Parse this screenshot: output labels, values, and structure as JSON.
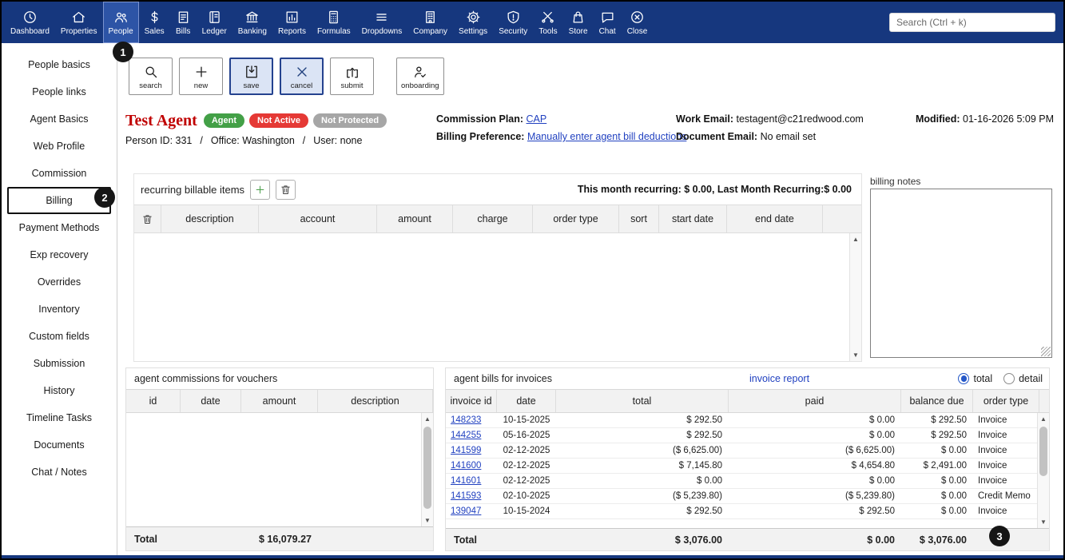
{
  "colors": {
    "nav_bg": "#16377e",
    "link": "#2141c0",
    "agent_name_red": "#c00000"
  },
  "annotations": {
    "one": "1",
    "two": "2",
    "three": "3"
  },
  "nav": {
    "search_placeholder": "Search (Ctrl + k)",
    "items": [
      {
        "label": "Dashboard",
        "icon": "dashboard-icon"
      },
      {
        "label": "Properties",
        "icon": "properties-icon"
      },
      {
        "label": "People",
        "icon": "people-icon",
        "selected": true
      },
      {
        "label": "Sales",
        "icon": "sales-icon"
      },
      {
        "label": "Bills",
        "icon": "bills-icon"
      },
      {
        "label": "Ledger",
        "icon": "ledger-icon"
      },
      {
        "label": "Banking",
        "icon": "banking-icon"
      },
      {
        "label": "Reports",
        "icon": "reports-icon"
      },
      {
        "label": "Formulas",
        "icon": "formulas-icon"
      },
      {
        "label": "Dropdowns",
        "icon": "dropdowns-icon"
      },
      {
        "label": "Company",
        "icon": "company-icon"
      },
      {
        "label": "Settings",
        "icon": "settings-icon"
      },
      {
        "label": "Security",
        "icon": "security-icon"
      },
      {
        "label": "Tools",
        "icon": "tools-icon"
      },
      {
        "label": "Store",
        "icon": "store-icon"
      },
      {
        "label": "Chat",
        "icon": "chat-icon"
      },
      {
        "label": "Close",
        "icon": "close-icon"
      }
    ]
  },
  "sidebar": {
    "selected": "Billing",
    "items": [
      "People basics",
      "People links",
      "Agent Basics",
      "Web Profile",
      "Commission",
      "Billing",
      "Payment Methods",
      "Exp recovery",
      "Overrides",
      "Inventory",
      "Custom fields",
      "Submission",
      "History",
      "Timeline Tasks",
      "Documents",
      "Chat / Notes"
    ]
  },
  "toolbar": {
    "buttons": [
      {
        "label": "search",
        "icon": "search-icon"
      },
      {
        "label": "new",
        "icon": "plus-icon"
      },
      {
        "label": "save",
        "icon": "save-icon",
        "highlighted": true
      },
      {
        "label": "cancel",
        "icon": "cancel-icon",
        "highlighted": true
      },
      {
        "label": "submit",
        "icon": "submit-icon"
      },
      {
        "label": "onboarding",
        "icon": "onboarding-icon",
        "spaced": true
      }
    ]
  },
  "agent": {
    "name": "Test Agent",
    "badges": [
      {
        "label": "Agent",
        "color": "#43a047"
      },
      {
        "label": "Not Active",
        "color": "#e53935"
      },
      {
        "label": "Not Protected",
        "color": "#a6a6a6"
      }
    ],
    "meta": {
      "person_id": "Person ID: 331",
      "separator": "/",
      "office": "Office: Washington",
      "user": "User: none"
    },
    "commission_plan_label": "Commission Plan:",
    "commission_plan_value": "CAP",
    "billing_pref_label": "Billing Preference:",
    "billing_pref_value": "Manually enter agent bill deductions",
    "work_email_label": "Work Email:",
    "work_email_value": "testagent@c21redwood.com",
    "document_email_label": "Document Email:",
    "document_email_value": "No email set",
    "modified_label": "Modified:",
    "modified_value": "01-16-2026 5:09 PM"
  },
  "recurring": {
    "title": "recurring billable items",
    "summary": "This month recurring: $ 0.00, Last Month Recurring:$ 0.00",
    "columns": [
      "description",
      "account",
      "amount",
      "charge",
      "order type",
      "sort",
      "start date",
      "end date"
    ]
  },
  "billing_notes": {
    "label": "billing notes"
  },
  "vouchers": {
    "title": "agent commissions for vouchers",
    "columns": [
      "id",
      "date",
      "amount",
      "description"
    ],
    "total_label": "Total",
    "total_amount": "$ 16,079.27"
  },
  "invoices": {
    "title": "agent bills for invoices",
    "report_link": "invoice report",
    "radio_total": "total",
    "radio_detail": "detail",
    "columns": [
      "invoice id",
      "date",
      "total",
      "paid",
      "balance due",
      "order type"
    ],
    "rows": [
      {
        "id": "148233",
        "date": "10-15-2025",
        "total": "$ 292.50",
        "paid": "$ 0.00",
        "balance": "$ 292.50",
        "type": "Invoice"
      },
      {
        "id": "144255",
        "date": "05-16-2025",
        "total": "$ 292.50",
        "paid": "$ 0.00",
        "balance": "$ 292.50",
        "type": "Invoice"
      },
      {
        "id": "141599",
        "date": "02-12-2025",
        "total": "($ 6,625.00)",
        "paid": "($ 6,625.00)",
        "balance": "$ 0.00",
        "type": "Invoice"
      },
      {
        "id": "141600",
        "date": "02-12-2025",
        "total": "$ 7,145.80",
        "paid": "$ 4,654.80",
        "balance": "$ 2,491.00",
        "type": "Invoice"
      },
      {
        "id": "141601",
        "date": "02-12-2025",
        "total": "$ 0.00",
        "paid": "$ 0.00",
        "balance": "$ 0.00",
        "type": "Invoice"
      },
      {
        "id": "141593",
        "date": "02-10-2025",
        "total": "($ 5,239.80)",
        "paid": "($ 5,239.80)",
        "balance": "$ 0.00",
        "type": "Credit Memo"
      },
      {
        "id": "139047",
        "date": "10-15-2024",
        "total": "$ 292.50",
        "paid": "$ 292.50",
        "balance": "$ 0.00",
        "type": "Invoice"
      }
    ],
    "total_label": "Total",
    "total_total": "$ 3,076.00",
    "total_paid": "$ 0.00",
    "total_balance": "$ 3,076.00"
  }
}
